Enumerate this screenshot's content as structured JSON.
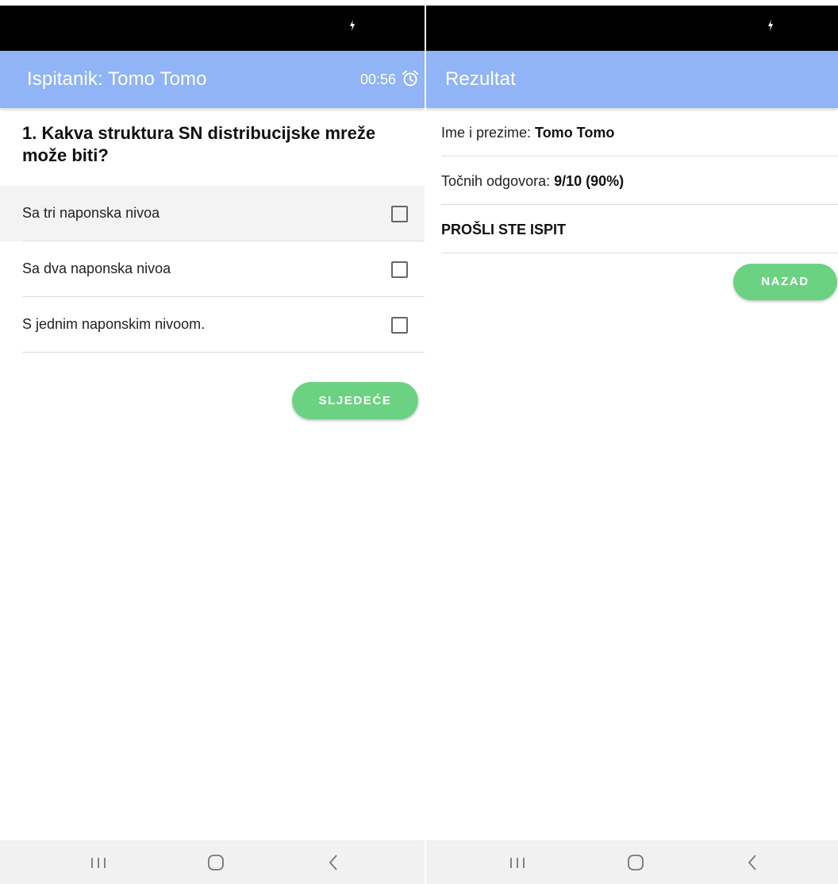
{
  "left_screen": {
    "appbar": {
      "title": "Ispitanik: Tomo Tomo",
      "timer": "00:56",
      "timer_icon": "alarm-clock-icon"
    },
    "question": "1. Kakva struktura SN distribucijske mreže može biti?",
    "options": [
      {
        "label": "Sa tri naponska nivoa",
        "checked": false
      },
      {
        "label": "Sa dva naponska nivoa",
        "checked": false
      },
      {
        "label": "S jednim naponskim nivoom.",
        "checked": false
      }
    ],
    "next_button": "SLJEDEĆE"
  },
  "right_screen": {
    "appbar": {
      "title": "Rezultat"
    },
    "name_label": "Ime i prezime: ",
    "name_value": "Tomo Tomo",
    "correct_label": "Točnih odgovora: ",
    "correct_value": "9/10 (90%)",
    "status": "PROŠLI STE ISPIT",
    "back_button": "NAZAD"
  },
  "navbar": {
    "icons": [
      "recent-apps-icon",
      "home-icon",
      "back-icon"
    ]
  },
  "colors": {
    "appbar": "#90b4f5",
    "button": "#6cd283",
    "statusbar": "#000000"
  }
}
